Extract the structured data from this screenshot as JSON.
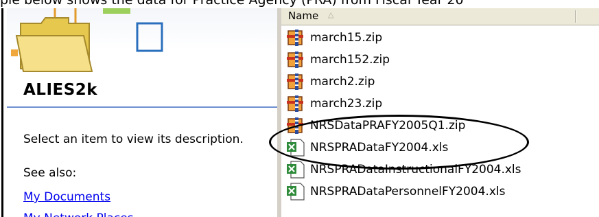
{
  "document": {
    "caption_line": "ple below shows the data for Practice Agency (PRA) from Fiscal Year 20"
  },
  "task_pane": {
    "folder_name": "ALIES2k",
    "description": "Select an item to view its description.",
    "see_also_label": "See also:",
    "links": [
      "My Documents",
      "My Network Places"
    ]
  },
  "file_list": {
    "column_header": "Name",
    "sort_indicator": "sort-ascending-icon",
    "files": [
      {
        "name": "march15.zip",
        "icon": "zip-archive-icon"
      },
      {
        "name": "march152.zip",
        "icon": "zip-archive-icon"
      },
      {
        "name": "march2.zip",
        "icon": "zip-archive-icon"
      },
      {
        "name": "march23.zip",
        "icon": "zip-archive-icon"
      },
      {
        "name": "NRSDataPRAFY2005Q1.zip",
        "icon": "zip-archive-icon",
        "highlighted": true
      },
      {
        "name": "NRSPRADataFY2004.xls",
        "icon": "excel-file-icon"
      },
      {
        "name": "NRSPRADataInstructionalFY2004.xls",
        "icon": "excel-file-icon"
      },
      {
        "name": "NRSPRADataPersonnelFY2004.xls",
        "icon": "excel-file-icon"
      }
    ]
  },
  "colors": {
    "link": "#0000ee",
    "folder_yellow": "#f2dc7e",
    "excel_green": "#2e8b3a",
    "zip_red": "#c8321e"
  }
}
